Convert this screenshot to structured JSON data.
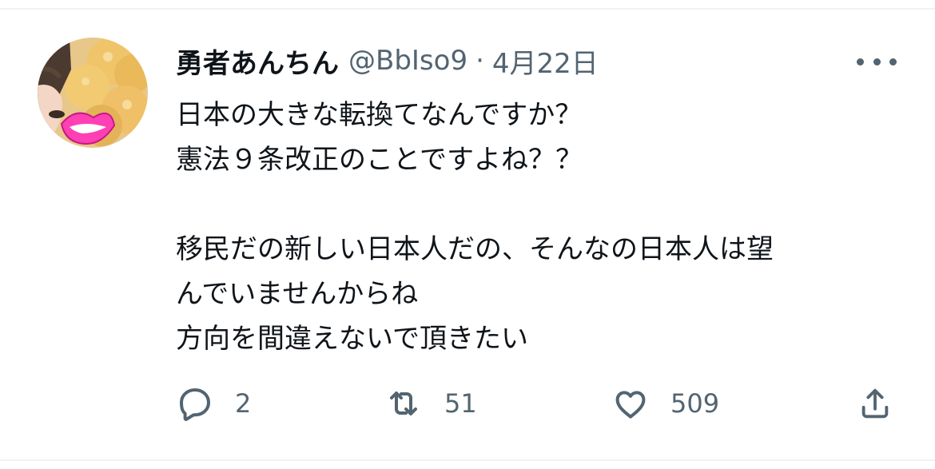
{
  "tweet": {
    "author": {
      "display_name": "勇者あんちん",
      "handle": "@BbIso9",
      "avatar_icon": "avatar-photo"
    },
    "separator": "·",
    "date": "4月22日",
    "more_icon": "more-dots-icon",
    "text_lines": [
      "日本の大きな転換てなんですか？",
      "憲法９条改正のことですよね？？",
      "",
      "移民だの新しい日本人だの、そんなの日本人は望",
      "んでいませんからね",
      "方向を間違えないで頂きたい"
    ],
    "actions": {
      "reply": {
        "icon": "reply-icon",
        "count": "2"
      },
      "retweet": {
        "icon": "retweet-icon",
        "count": "51"
      },
      "like": {
        "icon": "heart-icon",
        "count": "509"
      },
      "share": {
        "icon": "share-icon"
      }
    }
  },
  "colors": {
    "text_primary": "#0f1419",
    "text_secondary": "#536471",
    "divider": "#eff3f4",
    "avatar_lips": "#ff3fb4"
  }
}
